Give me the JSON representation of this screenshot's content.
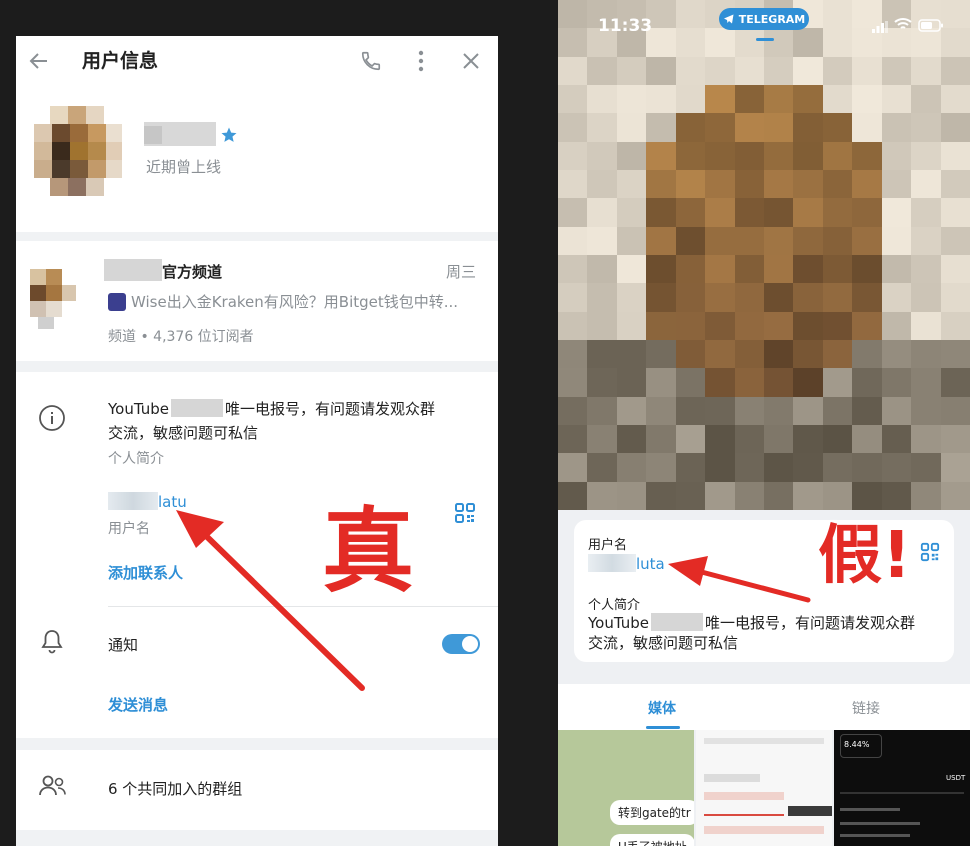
{
  "left_panel": {
    "header": {
      "title": "用户信息"
    },
    "profile": {
      "status": "近期曾上线"
    },
    "channel": {
      "name_suffix": "官方频道",
      "day": "周三",
      "preview": "Wise出入金Kraken有风险？用Bitget钱包中转...",
      "meta": "频道 • 4,376 位订阅者"
    },
    "info": {
      "bio_prefix": "YouTube",
      "bio_suffix": "唯一电报号，有问题请发观众群",
      "bio_line2": "交流，敏感问题可私信",
      "bio_caption": "个人简介",
      "username_suffix": "latu",
      "username_caption": "用户名",
      "add_contact": "添加联系人",
      "notify_label": "通知",
      "notify_on": 1,
      "send_message": "发送消息"
    },
    "groups": {
      "label": "6 个共同加入的群组"
    }
  },
  "annotation_left": "真",
  "annotation_right": "假!",
  "right_panel": {
    "status_bar": {
      "time": "11:33",
      "app_pill": "TELEGRAM"
    },
    "card": {
      "username_caption": "用户名",
      "username_suffix": "luta",
      "bio_caption": "个人简介",
      "bio_prefix": "YouTube",
      "bio_suffix": "唯一电报号，有问题请发观众群",
      "bio_line2": "交流，敏感问题可私信"
    },
    "tabs": [
      "媒体",
      "链接"
    ],
    "media_snippets": {
      "chat1": "转到gate的tr",
      "chat2": "U丢了被地址",
      "dark_value": "8.44%",
      "usdt_label": "USDT"
    }
  },
  "colors": {
    "accent": "#2f8fd6",
    "annotation_red": "#e32b25",
    "toggle": "#3f99d8"
  }
}
